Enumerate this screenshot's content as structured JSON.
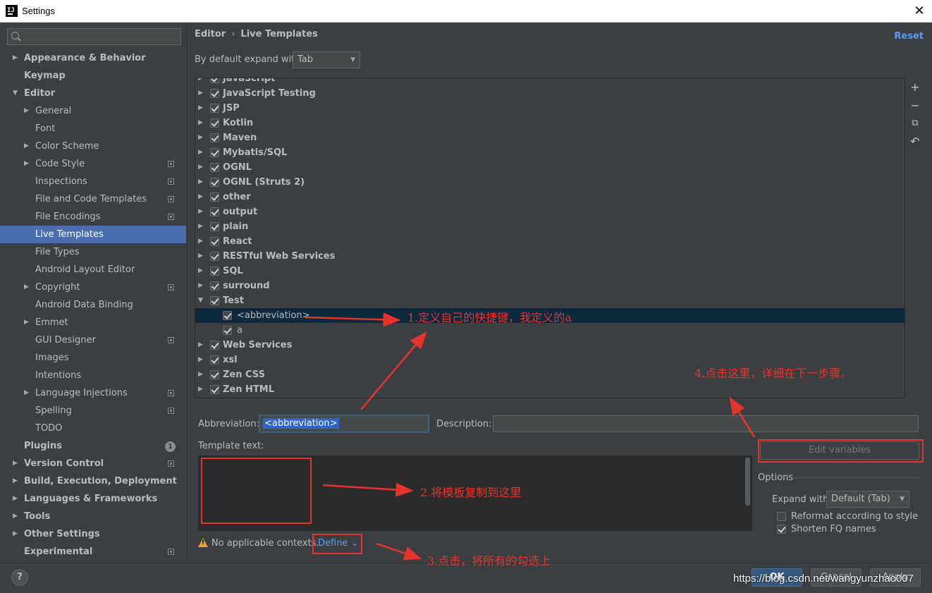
{
  "window": {
    "title": "Settings",
    "close_label": "✕"
  },
  "sidebar": {
    "search_placeholder": "",
    "items": [
      {
        "label": "Appearance & Behavior",
        "level": 0,
        "arrow": "▶",
        "selected": false,
        "project": false
      },
      {
        "label": "Keymap",
        "level": 0,
        "arrow": "",
        "selected": false,
        "project": false
      },
      {
        "label": "Editor",
        "level": 0,
        "arrow": "▼",
        "selected": false,
        "project": false
      },
      {
        "label": "General",
        "level": 1,
        "arrow": "▶",
        "selected": false,
        "project": false
      },
      {
        "label": "Font",
        "level": 1,
        "arrow": "",
        "selected": false,
        "project": false
      },
      {
        "label": "Color Scheme",
        "level": 1,
        "arrow": "▶",
        "selected": false,
        "project": false
      },
      {
        "label": "Code Style",
        "level": 1,
        "arrow": "▶",
        "selected": false,
        "project": true
      },
      {
        "label": "Inspections",
        "level": 1,
        "arrow": "",
        "selected": false,
        "project": true
      },
      {
        "label": "File and Code Templates",
        "level": 1,
        "arrow": "",
        "selected": false,
        "project": true
      },
      {
        "label": "File Encodings",
        "level": 1,
        "arrow": "",
        "selected": false,
        "project": true
      },
      {
        "label": "Live Templates",
        "level": 1,
        "arrow": "",
        "selected": true,
        "project": false
      },
      {
        "label": "File Types",
        "level": 1,
        "arrow": "",
        "selected": false,
        "project": false
      },
      {
        "label": "Android Layout Editor",
        "level": 1,
        "arrow": "",
        "selected": false,
        "project": false
      },
      {
        "label": "Copyright",
        "level": 1,
        "arrow": "▶",
        "selected": false,
        "project": true
      },
      {
        "label": "Android Data Binding",
        "level": 1,
        "arrow": "",
        "selected": false,
        "project": false
      },
      {
        "label": "Emmet",
        "level": 1,
        "arrow": "▶",
        "selected": false,
        "project": false
      },
      {
        "label": "GUI Designer",
        "level": 1,
        "arrow": "",
        "selected": false,
        "project": true
      },
      {
        "label": "Images",
        "level": 1,
        "arrow": "",
        "selected": false,
        "project": false
      },
      {
        "label": "Intentions",
        "level": 1,
        "arrow": "",
        "selected": false,
        "project": false
      },
      {
        "label": "Language Injections",
        "level": 1,
        "arrow": "▶",
        "selected": false,
        "project": true
      },
      {
        "label": "Spelling",
        "level": 1,
        "arrow": "",
        "selected": false,
        "project": true
      },
      {
        "label": "TODO",
        "level": 1,
        "arrow": "",
        "selected": false,
        "project": false
      },
      {
        "label": "Plugins",
        "level": 0,
        "arrow": "",
        "selected": false,
        "project": false,
        "badge": "1"
      },
      {
        "label": "Version Control",
        "level": 0,
        "arrow": "▶",
        "selected": false,
        "project": true
      },
      {
        "label": "Build, Execution, Deployment",
        "level": 0,
        "arrow": "▶",
        "selected": false,
        "project": false
      },
      {
        "label": "Languages & Frameworks",
        "level": 0,
        "arrow": "▶",
        "selected": false,
        "project": false
      },
      {
        "label": "Tools",
        "level": 0,
        "arrow": "▶",
        "selected": false,
        "project": false
      },
      {
        "label": "Other Settings",
        "level": 0,
        "arrow": "▶",
        "selected": false,
        "project": false
      },
      {
        "label": "Experimental",
        "level": 0,
        "arrow": "",
        "selected": false,
        "project": true
      }
    ]
  },
  "header": {
    "crumb_parent": "Editor",
    "crumb_sep": "›",
    "crumb_current": "Live Templates",
    "reset_label": "Reset"
  },
  "expand": {
    "label": "By default expand with",
    "value": "Tab"
  },
  "templates": [
    {
      "name": "JavaScript",
      "kind": "group",
      "arrow": "▶",
      "checked": true
    },
    {
      "name": "JavaScript Testing",
      "kind": "group",
      "arrow": "▶",
      "checked": true
    },
    {
      "name": "JSP",
      "kind": "group",
      "arrow": "▶",
      "checked": true
    },
    {
      "name": "Kotlin",
      "kind": "group",
      "arrow": "▶",
      "checked": true
    },
    {
      "name": "Maven",
      "kind": "group",
      "arrow": "▶",
      "checked": true
    },
    {
      "name": "Mybatis/SQL",
      "kind": "group",
      "arrow": "▶",
      "checked": true
    },
    {
      "name": "OGNL",
      "kind": "group",
      "arrow": "▶",
      "checked": true
    },
    {
      "name": "OGNL (Struts 2)",
      "kind": "group",
      "arrow": "▶",
      "checked": true
    },
    {
      "name": "other",
      "kind": "group",
      "arrow": "▶",
      "checked": true
    },
    {
      "name": "output",
      "kind": "group",
      "arrow": "▶",
      "checked": true
    },
    {
      "name": "plain",
      "kind": "group",
      "arrow": "▶",
      "checked": true
    },
    {
      "name": "React",
      "kind": "group",
      "arrow": "▶",
      "checked": true
    },
    {
      "name": "RESTful Web Services",
      "kind": "group",
      "arrow": "▶",
      "checked": true
    },
    {
      "name": "SQL",
      "kind": "group",
      "arrow": "▶",
      "checked": true
    },
    {
      "name": "surround",
      "kind": "group",
      "arrow": "▶",
      "checked": true
    },
    {
      "name": "Test",
      "kind": "group",
      "arrow": "▼",
      "checked": true
    },
    {
      "name": "<abbreviation>",
      "kind": "child",
      "arrow": "",
      "checked": true,
      "selected": true
    },
    {
      "name": "a",
      "kind": "child",
      "arrow": "",
      "checked": true
    },
    {
      "name": "Web Services",
      "kind": "group",
      "arrow": "▶",
      "checked": true
    },
    {
      "name": "xsl",
      "kind": "group",
      "arrow": "▶",
      "checked": true
    },
    {
      "name": "Zen CSS",
      "kind": "group",
      "arrow": "▶",
      "checked": true
    },
    {
      "name": "Zen HTML",
      "kind": "group",
      "arrow": "▶",
      "checked": true
    }
  ],
  "toolbar": {
    "add_icon": "+",
    "remove_icon": "−",
    "copy_icon": "⧉",
    "restore_icon": "↶"
  },
  "editor": {
    "abbreviation_label": "Abbreviation:",
    "abbreviation_value": "<abbreviation>",
    "description_label": "Description:",
    "description_value": "",
    "template_text_label": "Template text:",
    "template_text_value": "",
    "edit_variables_label": "Edit variables",
    "contexts_warning": "No applicable contexts.",
    "define_label": "Define",
    "define_chevron": "⌄"
  },
  "options": {
    "title": "Options",
    "expand_with_label": "Expand with",
    "expand_with_value": "Default (Tab)",
    "reformat_label": "Reformat according to style",
    "reformat_checked": false,
    "shorten_label": "Shorten FQ names",
    "shorten_checked": true
  },
  "footer": {
    "help_label": "?",
    "ok_label": "OK",
    "cancel_label": "Cancel",
    "apply_label": "Apply",
    "watermark": "https://blog.csdn.net/wangyunzhao007"
  },
  "annotations": {
    "step1": "1.定义自己的快捷键，我定义的a",
    "step2": "2.将模板复制到这里",
    "step3": "3.点击，将所有的勾选上",
    "step4": "4.点击这里，详细在下一步骤。",
    "color": "#e8332d"
  }
}
